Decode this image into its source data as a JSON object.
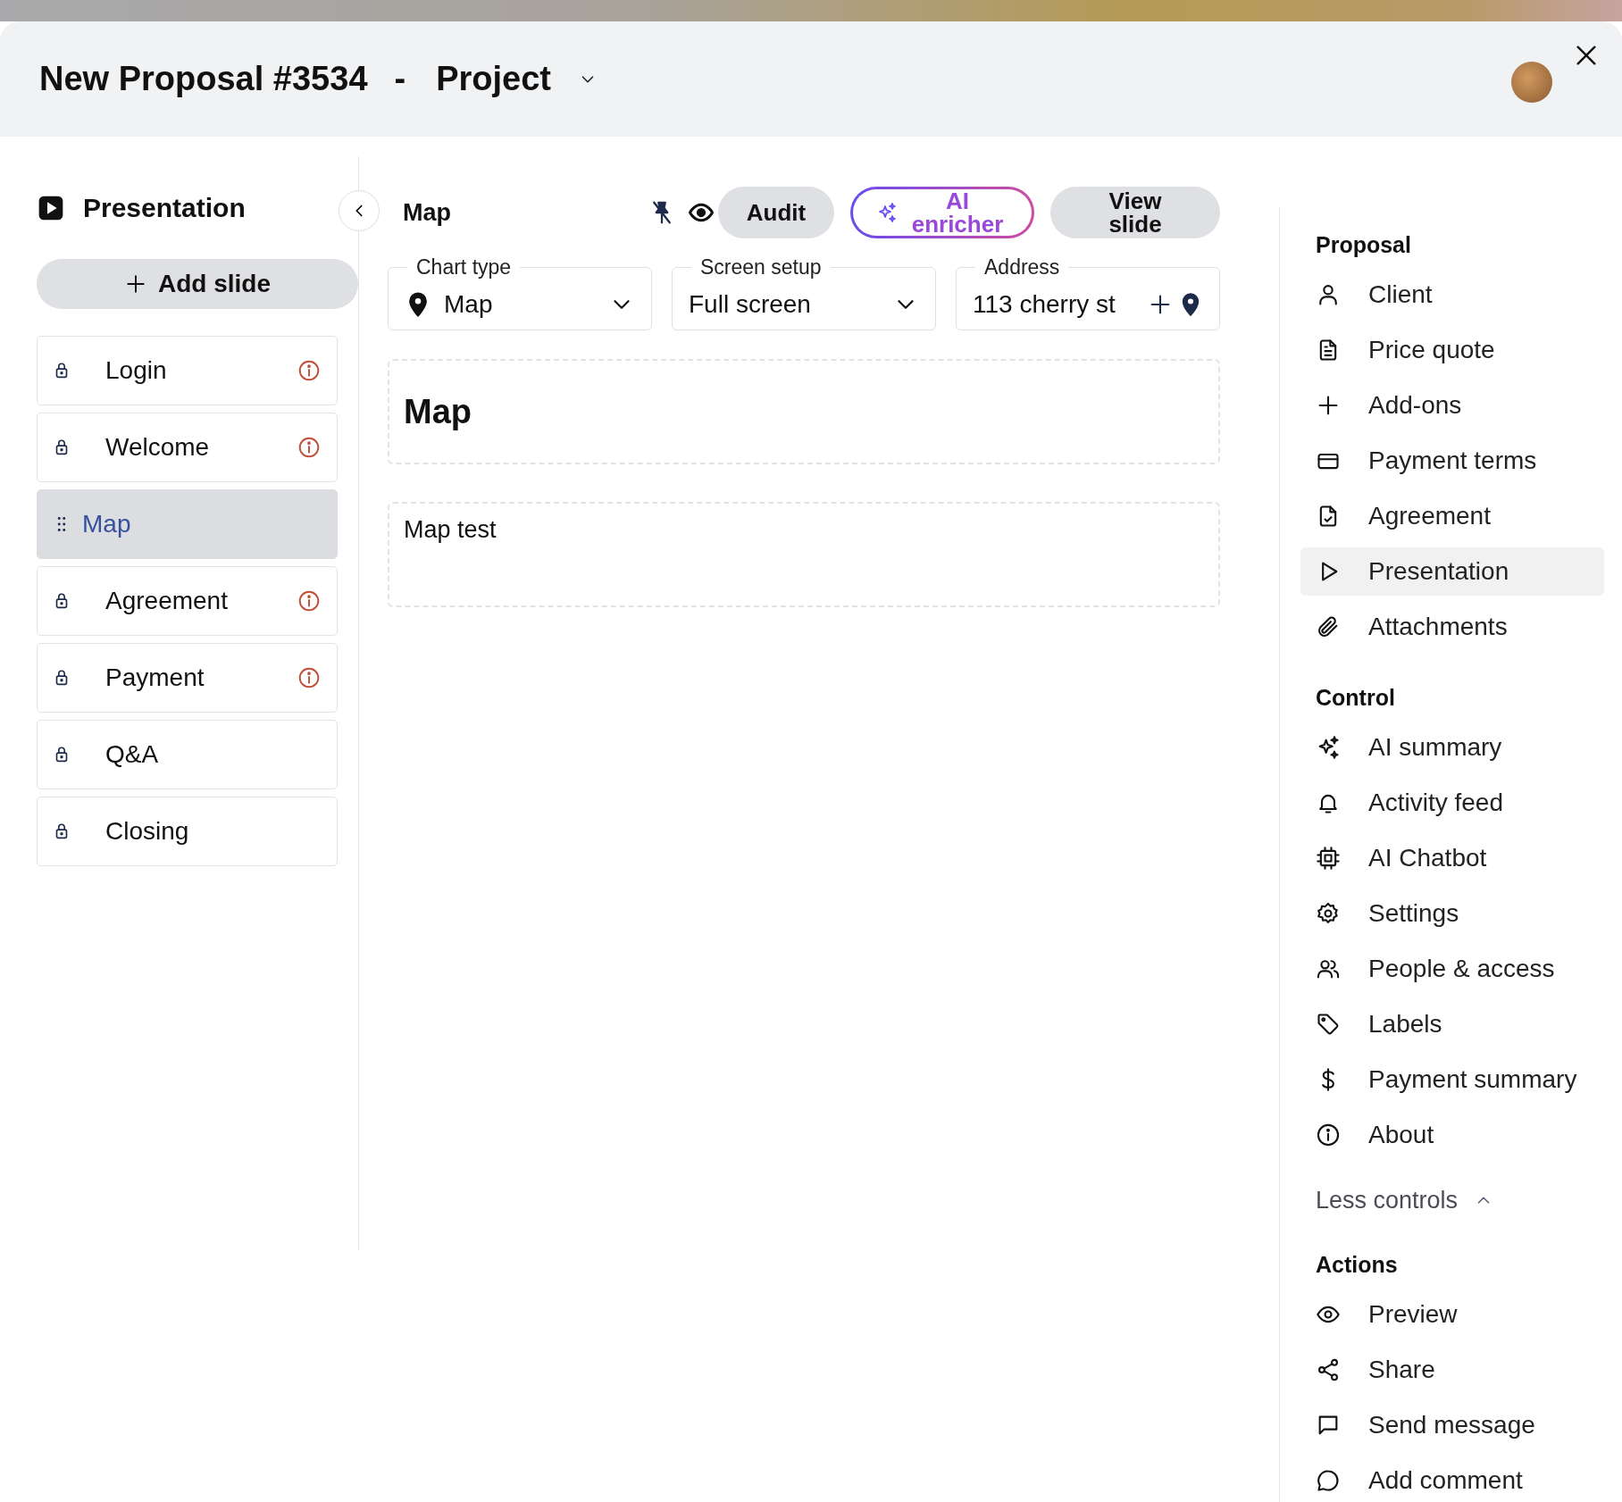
{
  "header": {
    "title": "New Proposal #3534",
    "separator": "-",
    "project": "Project"
  },
  "left_panel": {
    "title": "Presentation",
    "add_button": "Add slide",
    "slides": [
      {
        "label": "Login",
        "selected": false,
        "warning": true
      },
      {
        "label": "Welcome",
        "selected": false,
        "warning": true
      },
      {
        "label": "Map",
        "selected": true,
        "warning": false
      },
      {
        "label": "Agreement",
        "selected": false,
        "warning": true
      },
      {
        "label": "Payment",
        "selected": false,
        "warning": true
      },
      {
        "label": "Q&A",
        "selected": false,
        "warning": false
      },
      {
        "label": "Closing",
        "selected": false,
        "warning": false
      }
    ]
  },
  "editor": {
    "title": "Map",
    "pinned": false,
    "buttons": [
      {
        "label": "Audit",
        "kind": "plain"
      },
      {
        "label": "AI enricher",
        "kind": "ai"
      },
      {
        "label": "View slide",
        "kind": "plain"
      }
    ],
    "fields": [
      {
        "label": "Chart type",
        "value": "Map",
        "kind": "icon-select"
      },
      {
        "label": "Screen setup",
        "value": "Full screen",
        "kind": "select"
      },
      {
        "label": "Address",
        "value": "113 cherry st",
        "kind": "location"
      }
    ],
    "heading": "Map",
    "body": "Map test"
  },
  "sidebar": {
    "sections": [
      {
        "title": "Proposal",
        "items": [
          {
            "label": "Client",
            "selected": false
          },
          {
            "label": "Price quote",
            "selected": false
          },
          {
            "label": "Add-ons",
            "selected": false
          },
          {
            "label": "Payment terms",
            "selected": false
          },
          {
            "label": "Agreement",
            "selected": false
          },
          {
            "label": "Presentation",
            "selected": true
          },
          {
            "label": "Attachments",
            "selected": false
          }
        ]
      },
      {
        "title": "Control",
        "items": [
          {
            "label": "AI summary",
            "selected": false
          },
          {
            "label": "Activity feed",
            "selected": false
          },
          {
            "label": "AI Chatbot",
            "selected": false
          },
          {
            "label": "Settings",
            "selected": false
          },
          {
            "label": "People & access",
            "selected": false
          },
          {
            "label": "Labels",
            "selected": false
          },
          {
            "label": "Payment summary",
            "selected": false
          },
          {
            "label": "About",
            "selected": false
          }
        ],
        "toggle": {
          "label": "Less controls",
          "expanded": true
        }
      },
      {
        "title": "Actions",
        "items": [
          {
            "label": "Preview",
            "selected": false
          },
          {
            "label": "Share",
            "selected": false
          },
          {
            "label": "Send message",
            "selected": false
          },
          {
            "label": "Add comment",
            "selected": false
          }
        ]
      }
    ]
  }
}
